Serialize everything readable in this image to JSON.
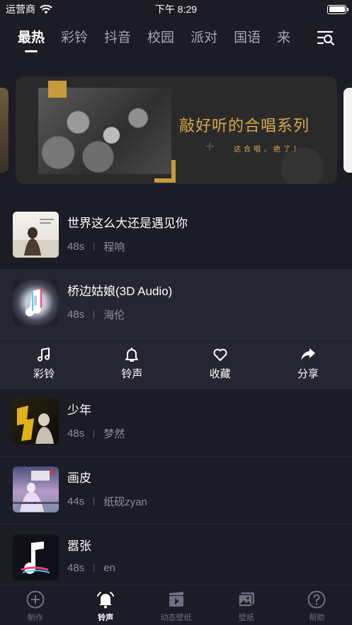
{
  "status_bar": {
    "carrier": "运营商",
    "time": "下午 8:29"
  },
  "tabs": [
    {
      "label": "最热",
      "active": true
    },
    {
      "label": "彩铃",
      "active": false
    },
    {
      "label": "抖音",
      "active": false
    },
    {
      "label": "校园",
      "active": false
    },
    {
      "label": "派对",
      "active": false
    },
    {
      "label": "国语",
      "active": false
    },
    {
      "label": "来",
      "active": false
    }
  ],
  "banner": {
    "title": "敲好听的合唱系列",
    "subtitle": "这合唱，绝了！"
  },
  "songs": [
    {
      "title": "世界这么大还是遇见你",
      "duration": "48s",
      "artist": "程响",
      "cover_icon": "album-cover-lady-icon"
    },
    {
      "title": "桥边姑娘(3D Audio)",
      "duration": "48s",
      "artist": "海伦",
      "cover_icon": "music-note-logo-icon"
    },
    {
      "title": "少年",
      "duration": "48s",
      "artist": "梦然",
      "cover_icon": "album-cover-shaonian-icon"
    },
    {
      "title": "画皮",
      "duration": "44s",
      "artist": "纸砚zyan",
      "cover_icon": "album-cover-huapi-icon"
    },
    {
      "title": "嚣张",
      "duration": "48s",
      "artist": "en",
      "cover_icon": "music-note-logo-icon"
    }
  ],
  "actions": [
    {
      "label": "彩铃",
      "icon": "music-note-icon"
    },
    {
      "label": "铃声",
      "icon": "bell-icon"
    },
    {
      "label": "收藏",
      "icon": "heart-icon"
    },
    {
      "label": "分享",
      "icon": "share-icon"
    }
  ],
  "bottom_nav": [
    {
      "label": "制作",
      "icon": "plus-circle-icon",
      "active": false
    },
    {
      "label": "铃声",
      "icon": "bell-icon",
      "active": true
    },
    {
      "label": "动态壁纸",
      "icon": "video-icon",
      "active": false
    },
    {
      "label": "壁纸",
      "icon": "image-icon",
      "active": false
    },
    {
      "label": "帮助",
      "icon": "help-icon",
      "active": false
    }
  ],
  "colors": {
    "background": "#1b1c26",
    "expanded_row": "#252631",
    "banner_gold": "#d7a84b",
    "secondary_text": "#8d8f9a"
  }
}
